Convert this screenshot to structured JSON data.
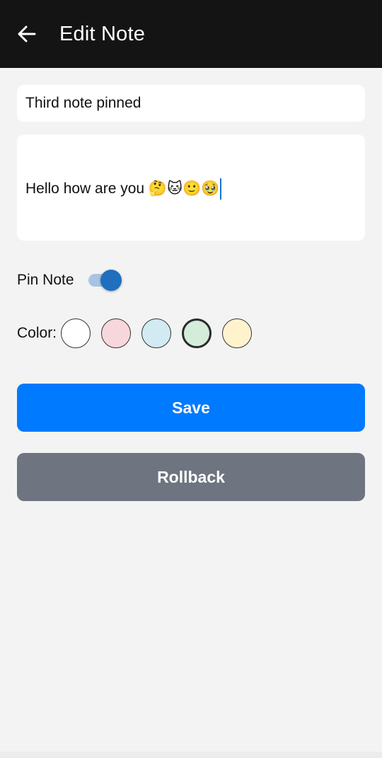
{
  "header": {
    "title": "Edit Note",
    "back_icon": "arrow-left-icon"
  },
  "form": {
    "title_value": "Third note pinned",
    "body_value": "Hello how are you 🤔🐱🙂🥹",
    "pin_label": "Pin Note",
    "pin_on": true,
    "color_label": "Color:",
    "colors": [
      "#ffffff",
      "#f8d7dc",
      "#d2eaf2",
      "#d4edda",
      "#fff3cd"
    ],
    "selected_color": "#d4edda",
    "toggle_on_color": "#1f6fbf"
  },
  "actions": {
    "save_label": "Save",
    "rollback_label": "Rollback",
    "save_color": "#007aff",
    "rollback_color": "#6e7580"
  }
}
